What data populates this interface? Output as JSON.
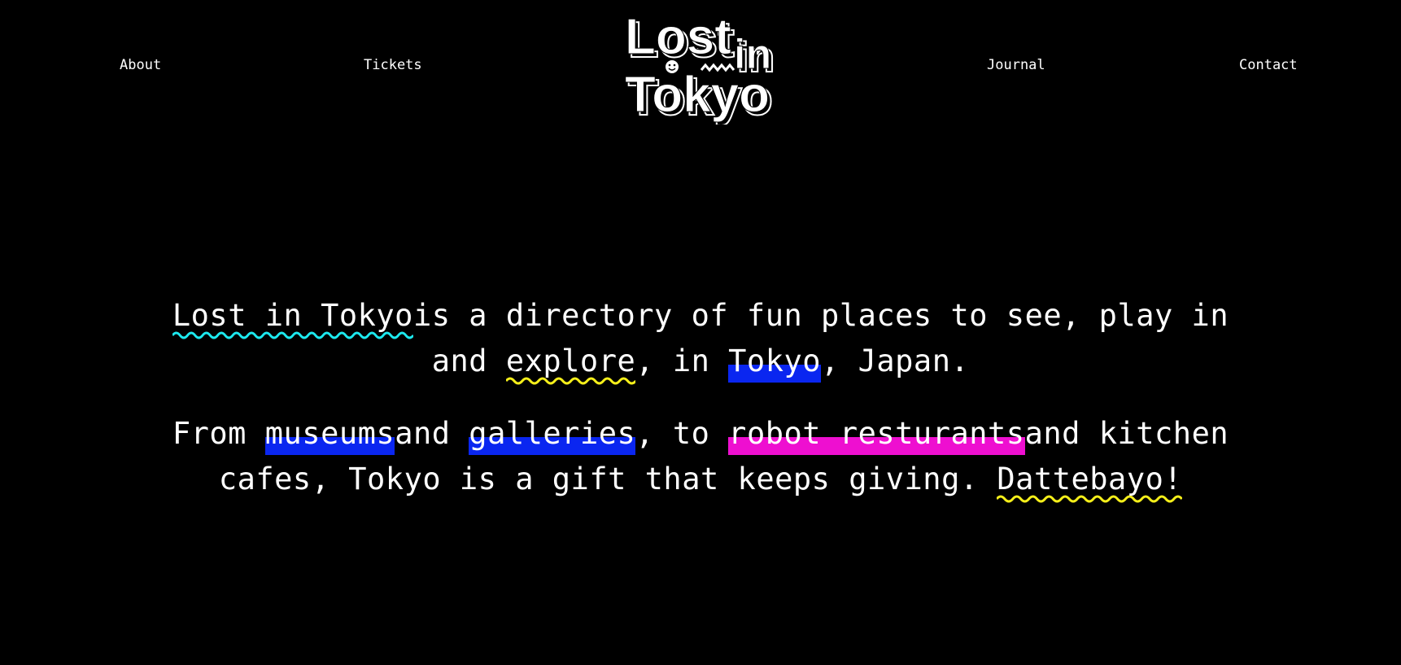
{
  "nav": {
    "about": "About",
    "tickets": "Tickets",
    "journal": "Journal",
    "contact": "Contact"
  },
  "logo": {
    "line1": "Lost",
    "line1b": "in",
    "line2": "Tokyo",
    "icon": "smiley-face-icon"
  },
  "colors": {
    "background": "#000000",
    "text": "#ffffff",
    "cyan": "#1de9ef",
    "yellow": "#f5ef1a",
    "blue": "#0a26f0",
    "magenta": "#ee0fd0"
  },
  "intro": {
    "p1": {
      "hl_site": "Lost in Tokyo ",
      "t1": "is a directory of fun places to see, play in and ",
      "hl_explore": "explore",
      "t2": ", in ",
      "hl_tokyo": "Tokyo",
      "t3": ", Japan."
    },
    "p2": {
      "t1": "From ",
      "hl_museums": "museums",
      "t2": "and ",
      "hl_galleries": "galleries",
      "t3": ", to ",
      "hl_robot": "robot resturants ",
      "t4": "and kitchen cafes, Tokyo is a gift that keeps giving. ",
      "hl_dattebayo": "Dattebayo!"
    }
  }
}
